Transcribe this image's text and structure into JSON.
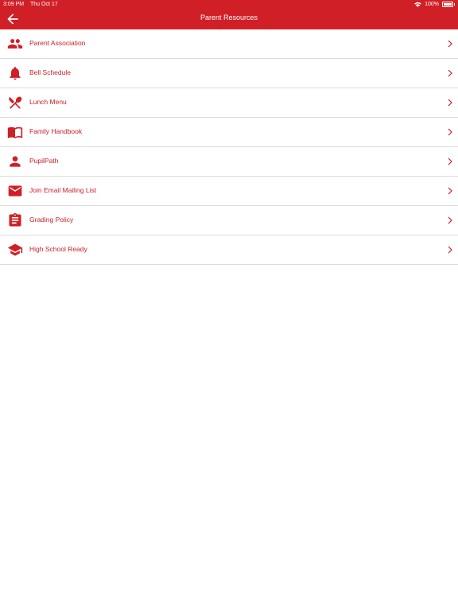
{
  "status_bar": {
    "time": "3:09 PM",
    "date": "Thu Oct 17",
    "battery": "100%"
  },
  "header": {
    "title": "Parent Resources",
    "back_icon": "arrow-left-icon"
  },
  "colors": {
    "brand_red": "#d01f26",
    "text_red": "#c8202a"
  },
  "items": [
    {
      "label": "Parent Association",
      "icon": "people-icon"
    },
    {
      "label": "Bell Schedule",
      "icon": "bell-icon"
    },
    {
      "label": "Lunch Menu",
      "icon": "utensils-icon"
    },
    {
      "label": "Family Handbook",
      "icon": "book-icon"
    },
    {
      "label": "PupilPath",
      "icon": "person-icon"
    },
    {
      "label": "Join Email Mailing List",
      "icon": "mail-icon"
    },
    {
      "label": "Grading Policy",
      "icon": "clipboard-icon"
    },
    {
      "label": "High School Ready",
      "icon": "graduation-cap-icon"
    }
  ]
}
